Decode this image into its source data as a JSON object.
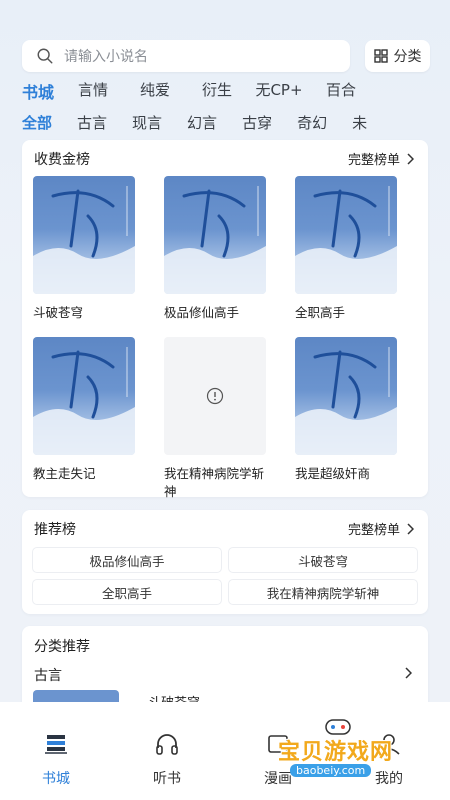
{
  "search": {
    "placeholder": "请输入小说名",
    "category_label": "分类"
  },
  "tabs_primary": [
    "书城",
    "言情",
    "纯爱",
    "衍生",
    "无CP+",
    "百合"
  ],
  "tabs_secondary": [
    "全部",
    "古言",
    "现言",
    "幻言",
    "古穿",
    "奇幻",
    "未"
  ],
  "paid_ranking": {
    "title": "收费金榜",
    "more": "完整榜单",
    "books": [
      {
        "title": "斗破苍穹",
        "cover": "image"
      },
      {
        "title": "极品修仙高手",
        "cover": "image"
      },
      {
        "title": "全职高手",
        "cover": "image"
      },
      {
        "title": "教主走失记",
        "cover": "image"
      },
      {
        "title": "我在精神病院学斩神",
        "cover": "placeholder"
      },
      {
        "title": "我是超级奸商",
        "cover": "image"
      }
    ]
  },
  "recommend": {
    "title": "推荐榜",
    "more": "完整榜单",
    "items": [
      "极品修仙高手",
      "斗破苍穹",
      "全职高手",
      "我在精神病院学斩神"
    ]
  },
  "category_rec": {
    "title": "分类推荐",
    "subtitle": "古言",
    "partial_book": "斗破苍穹"
  },
  "bottom_nav": [
    "书城",
    "听书",
    "漫画",
    "我的"
  ],
  "watermark": {
    "text": "宝贝游戏网",
    "url": "baobeiy.com"
  },
  "colors": {
    "accent": "#2f80d8",
    "cover_blue": "#5d87c5"
  }
}
